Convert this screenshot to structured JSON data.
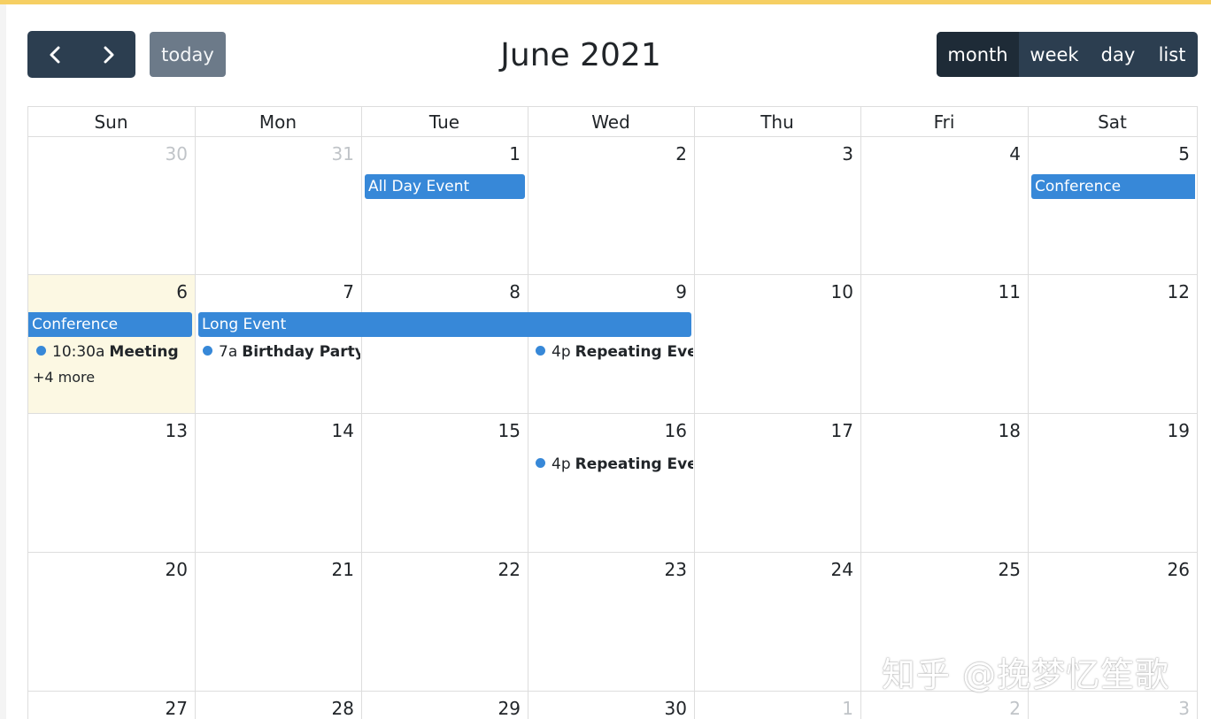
{
  "toolbar": {
    "prev_icon": "chevron-left-icon",
    "next_icon": "chevron-right-icon",
    "today_label": "today",
    "title": "June 2021",
    "views": [
      "month",
      "week",
      "day",
      "list"
    ],
    "active_view": "month"
  },
  "weekdays": [
    "Sun",
    "Mon",
    "Tue",
    "Wed",
    "Thu",
    "Fri",
    "Sat"
  ],
  "weeks": [
    [
      {
        "num": "30",
        "other": true
      },
      {
        "num": "31",
        "other": true
      },
      {
        "num": "1"
      },
      {
        "num": "2"
      },
      {
        "num": "3"
      },
      {
        "num": "4"
      },
      {
        "num": "5"
      }
    ],
    [
      {
        "num": "6",
        "today": true
      },
      {
        "num": "7"
      },
      {
        "num": "8"
      },
      {
        "num": "9"
      },
      {
        "num": "10"
      },
      {
        "num": "11"
      },
      {
        "num": "12"
      }
    ],
    [
      {
        "num": "13"
      },
      {
        "num": "14"
      },
      {
        "num": "15"
      },
      {
        "num": "16"
      },
      {
        "num": "17"
      },
      {
        "num": "18"
      },
      {
        "num": "19"
      }
    ],
    [
      {
        "num": "20"
      },
      {
        "num": "21"
      },
      {
        "num": "22"
      },
      {
        "num": "23"
      },
      {
        "num": "24"
      },
      {
        "num": "25"
      },
      {
        "num": "26"
      }
    ],
    [
      {
        "num": "27"
      },
      {
        "num": "28"
      },
      {
        "num": "29"
      },
      {
        "num": "30"
      },
      {
        "num": "1",
        "other": true
      },
      {
        "num": "2",
        "other": true
      },
      {
        "num": "3",
        "other": true
      }
    ]
  ],
  "events": {
    "all_day_event": "All Day Event",
    "conference_a": "Conference",
    "conference_b": "Conference",
    "long_event": "Long Event",
    "meeting": {
      "time": "10:30a",
      "title": "Meeting"
    },
    "birthday": {
      "time": "7a",
      "title": "Birthday Party"
    },
    "repeating_1": {
      "time": "4p",
      "title": "Repeating Event"
    },
    "repeating_2": {
      "time": "4p",
      "title": "Repeating Event"
    },
    "more": "+4 more"
  },
  "colors": {
    "accent_bar": "#f6cf63",
    "button_dark": "#2c3e50",
    "event_blue": "#3788d8",
    "today_highlight": "#fcf8e3"
  },
  "watermark": "知乎 @挽梦忆笙歌"
}
